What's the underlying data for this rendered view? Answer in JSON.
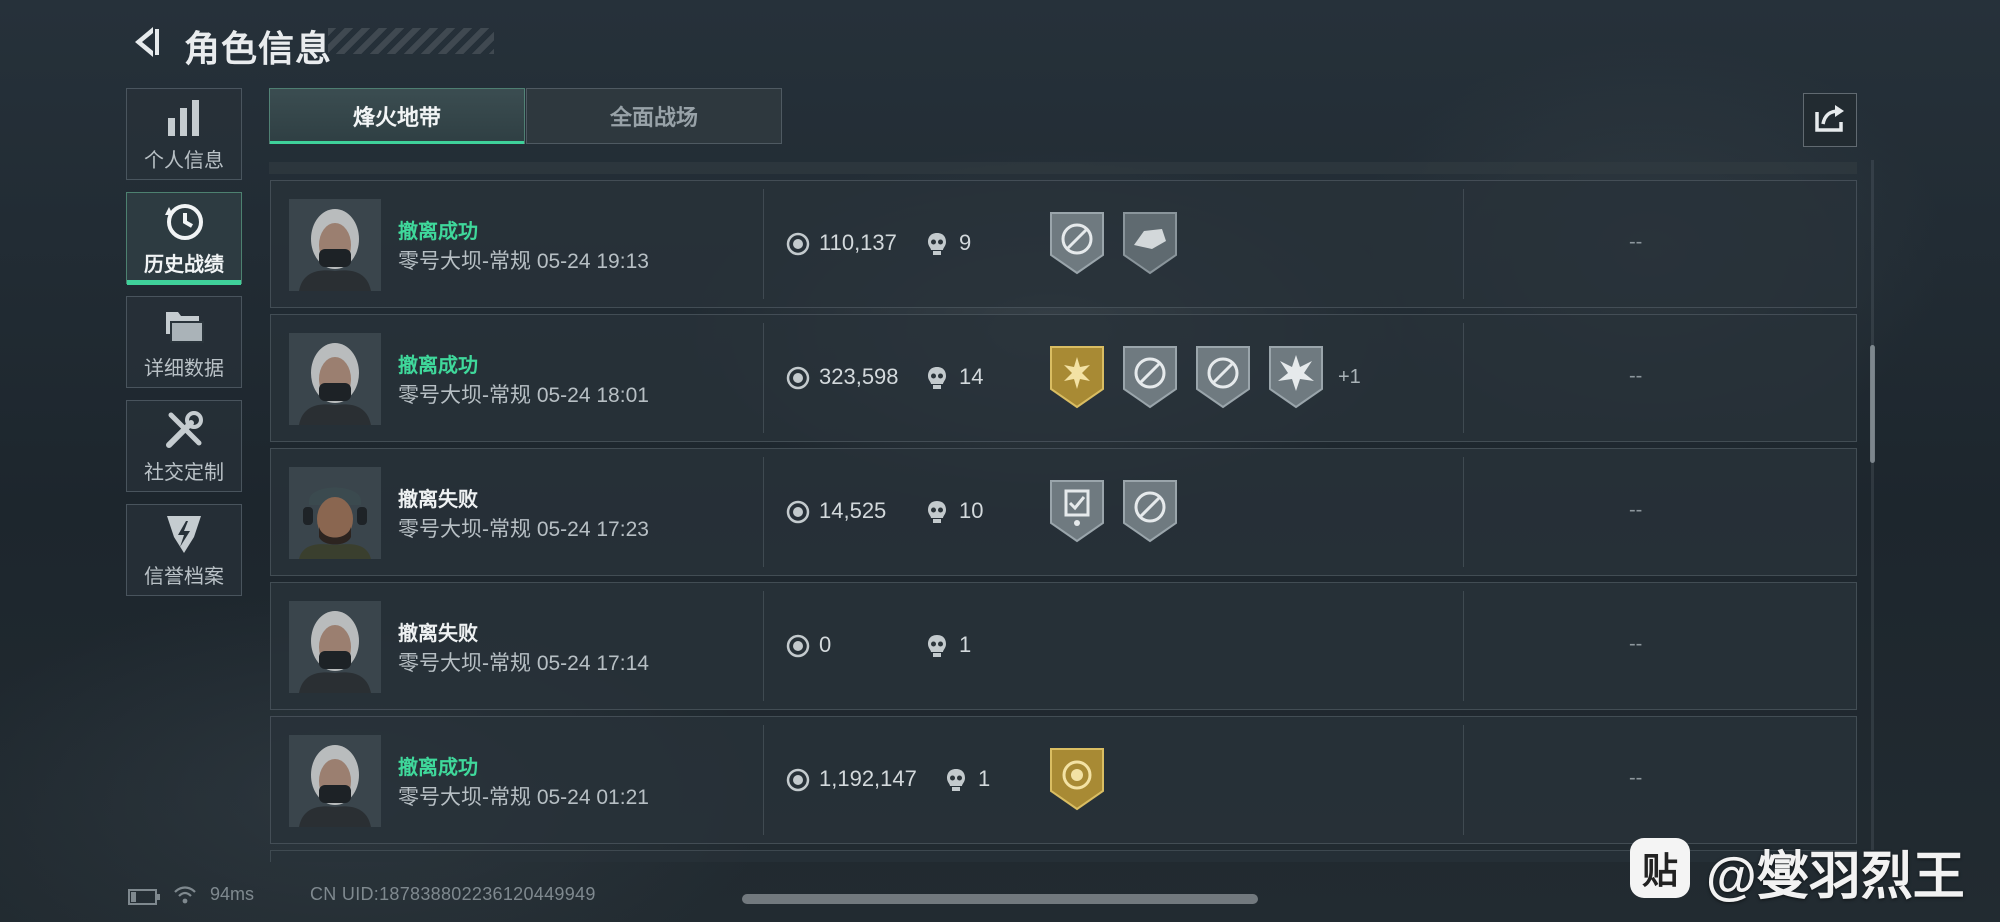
{
  "header": {
    "title": "角色信息"
  },
  "sidebar": {
    "items": [
      {
        "label": "个人信息",
        "icon": "bar-chart-icon"
      },
      {
        "label": "历史战绩",
        "icon": "history-clock-icon"
      },
      {
        "label": "详细数据",
        "icon": "folder-stack-icon"
      },
      {
        "label": "社交定制",
        "icon": "tools-icon"
      },
      {
        "label": "信誉档案",
        "icon": "credit-shield-icon"
      }
    ]
  },
  "tabs": [
    {
      "label": "烽火地带",
      "active": true
    },
    {
      "label": "全面战场",
      "active": false
    }
  ],
  "colors": {
    "accent": "#3fd19a",
    "gold_badge": "#c8a84a",
    "silver_badge": "#8e9aa0"
  },
  "matches": [
    {
      "status": "撤离成功",
      "map": "零号大坝-常规 05-24 19:13",
      "value": "110,137",
      "kills": "9",
      "badges": [
        "silver-target",
        "silver-vehicle"
      ],
      "extra": "",
      "result": "--"
    },
    {
      "status": "撤离成功",
      "map": "零号大坝-常规 05-24 18:01",
      "value": "323,598",
      "kills": "14",
      "badges": [
        "gold-burst",
        "silver-target",
        "silver-target",
        "silver-explosion"
      ],
      "extra": "+1",
      "result": "--"
    },
    {
      "status": "撤离失败",
      "map": "零号大坝-常规 05-24 17:23",
      "value": "14,525",
      "kills": "10",
      "badges": [
        "silver-clipboard",
        "silver-target"
      ],
      "extra": "",
      "result": "--"
    },
    {
      "status": "撤离失败",
      "map": "零号大坝-常规 05-24 17:14",
      "value": "0",
      "kills": "1",
      "badges": [],
      "extra": "",
      "result": "--"
    },
    {
      "status": "撤离成功",
      "map": "零号大坝-常规 05-24 01:21",
      "value": "1,192,147",
      "kills": "1",
      "badges": [
        "gold-coin"
      ],
      "extra": "",
      "result": "--"
    }
  ],
  "footer": {
    "ping": "94ms",
    "uid": "CN UID:187838802236120449949"
  },
  "watermark": {
    "logo": "贴",
    "text": "@燮羽烈王"
  }
}
